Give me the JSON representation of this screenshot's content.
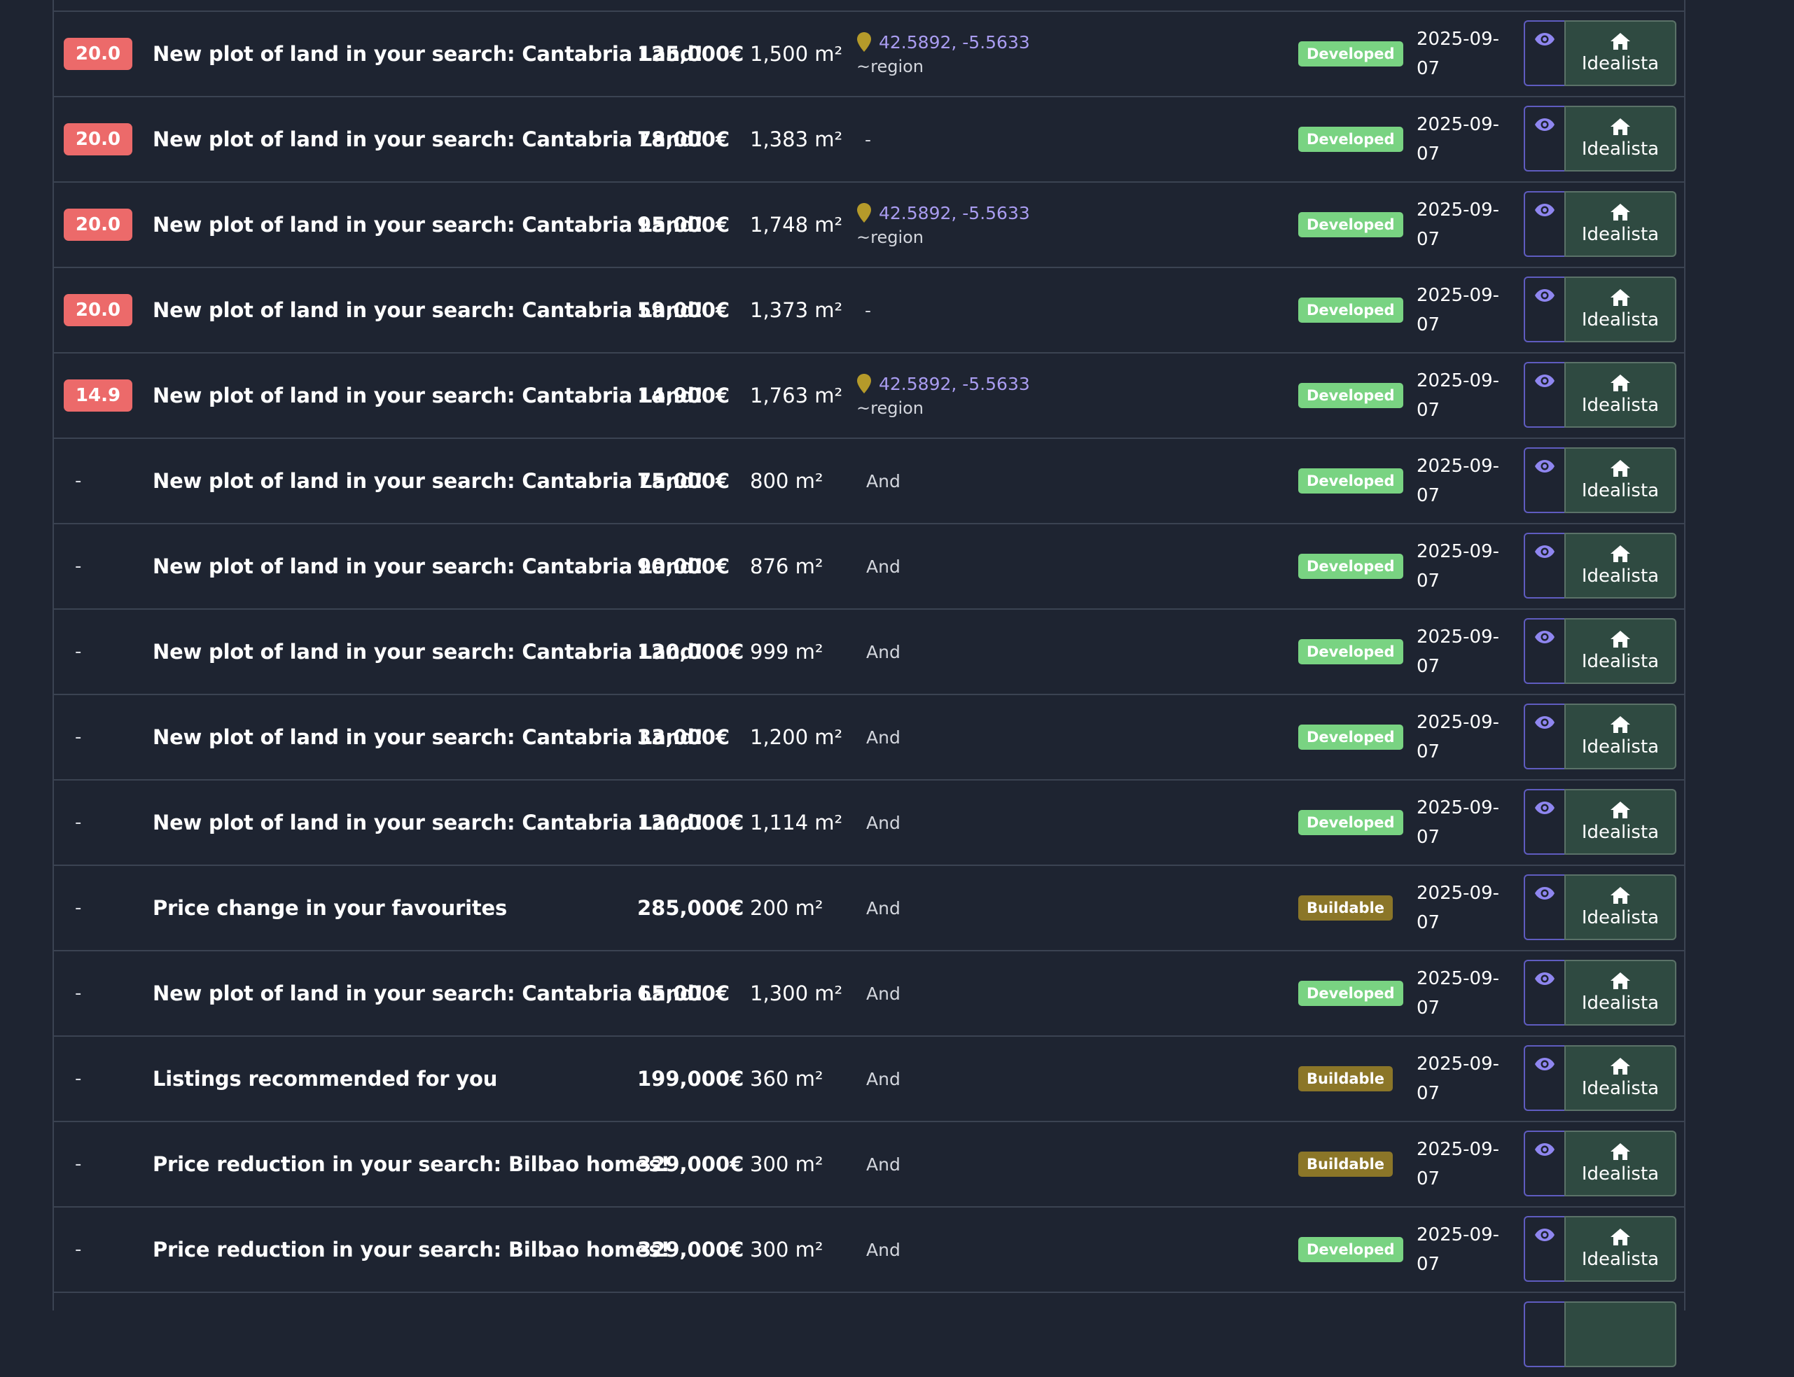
{
  "rows": [
    {
      "score": "20.0",
      "title": "New plot of land in your search: Cantabria Land!",
      "price": "125,000€",
      "area": "1,500 m²",
      "location": {
        "coords": "42.5892, -5.5633",
        "region": "~region"
      },
      "status": "Developed",
      "date": "2025-09-07",
      "source": "Idealista"
    },
    {
      "score": "20.0",
      "title": "New plot of land in your search: Cantabria Land!",
      "price": "78,000€",
      "area": "1,383 m²",
      "location": {
        "text": "-"
      },
      "status": "Developed",
      "date": "2025-09-07",
      "source": "Idealista"
    },
    {
      "score": "20.0",
      "title": "New plot of land in your search: Cantabria Land!",
      "price": "95,000€",
      "area": "1,748 m²",
      "location": {
        "coords": "42.5892, -5.5633",
        "region": "~region"
      },
      "status": "Developed",
      "date": "2025-09-07",
      "source": "Idealista"
    },
    {
      "score": "20.0",
      "title": "New plot of land in your search: Cantabria Land!",
      "price": "59,000€",
      "area": "1,373 m²",
      "location": {
        "text": "-"
      },
      "status": "Developed",
      "date": "2025-09-07",
      "source": "Idealista"
    },
    {
      "score": "14.9",
      "title": "New plot of land in your search: Cantabria Land!",
      "price": "14,900€",
      "area": "1,763 m²",
      "location": {
        "coords": "42.5892, -5.5633",
        "region": "~region"
      },
      "status": "Developed",
      "date": "2025-09-07",
      "source": "Idealista"
    },
    {
      "score": "-",
      "title": "New plot of land in your search: Cantabria Land!",
      "price": "75,000€",
      "area": "800 m²",
      "location": {
        "text": "And"
      },
      "status": "Developed",
      "date": "2025-09-07",
      "source": "Idealista"
    },
    {
      "score": "-",
      "title": "New plot of land in your search: Cantabria Land!",
      "price": "90,000€",
      "area": "876 m²",
      "location": {
        "text": "And"
      },
      "status": "Developed",
      "date": "2025-09-07",
      "source": "Idealista"
    },
    {
      "score": "-",
      "title": "New plot of land in your search: Cantabria Land!",
      "price": "120,000€",
      "area": "999 m²",
      "location": {
        "text": "And"
      },
      "status": "Developed",
      "date": "2025-09-07",
      "source": "Idealista"
    },
    {
      "score": "-",
      "title": "New plot of land in your search: Cantabria Land!",
      "price": "33,000€",
      "area": "1,200 m²",
      "location": {
        "text": "And"
      },
      "status": "Developed",
      "date": "2025-09-07",
      "source": "Idealista"
    },
    {
      "score": "-",
      "title": "New plot of land in your search: Cantabria Land!",
      "price": "120,000€",
      "area": "1,114 m²",
      "location": {
        "text": "And"
      },
      "status": "Developed",
      "date": "2025-09-07",
      "source": "Idealista"
    },
    {
      "score": "-",
      "title": "Price change in your favourites",
      "price": "285,000€",
      "area": "200 m²",
      "location": {
        "text": "And"
      },
      "status": "Buildable",
      "date": "2025-09-07",
      "source": "Idealista"
    },
    {
      "score": "-",
      "title": "New plot of land in your search: Cantabria Land!",
      "price": "65,000€",
      "area": "1,300 m²",
      "location": {
        "text": "And"
      },
      "status": "Developed",
      "date": "2025-09-07",
      "source": "Idealista"
    },
    {
      "score": "-",
      "title": "Listings recommended for you",
      "price": "199,000€",
      "area": "360 m²",
      "location": {
        "text": "And"
      },
      "status": "Buildable",
      "date": "2025-09-07",
      "source": "Idealista"
    },
    {
      "score": "-",
      "title": "Price reduction in your search: Bilbao homes!",
      "price": "329,000€",
      "area": "300 m²",
      "location": {
        "text": "And"
      },
      "status": "Buildable",
      "date": "2025-09-07",
      "source": "Idealista"
    },
    {
      "score": "-",
      "title": "Price reduction in your search: Bilbao homes!",
      "price": "329,000€",
      "area": "300 m²",
      "location": {
        "text": "And"
      },
      "status": "Developed",
      "date": "2025-09-07",
      "source": "Idealista"
    }
  ],
  "colors": {
    "background": "#1e2431",
    "score_high": "#ec6a6a",
    "developed": "#79d382",
    "buildable": "#8b7628",
    "coords": "#a99cf0",
    "pin": "#b59a2a",
    "eye": "#8f86f0",
    "idealista_button": "#2f4a41"
  },
  "icons": {
    "location": "map-pin-icon",
    "view": "eye-icon",
    "source": "home-icon"
  }
}
